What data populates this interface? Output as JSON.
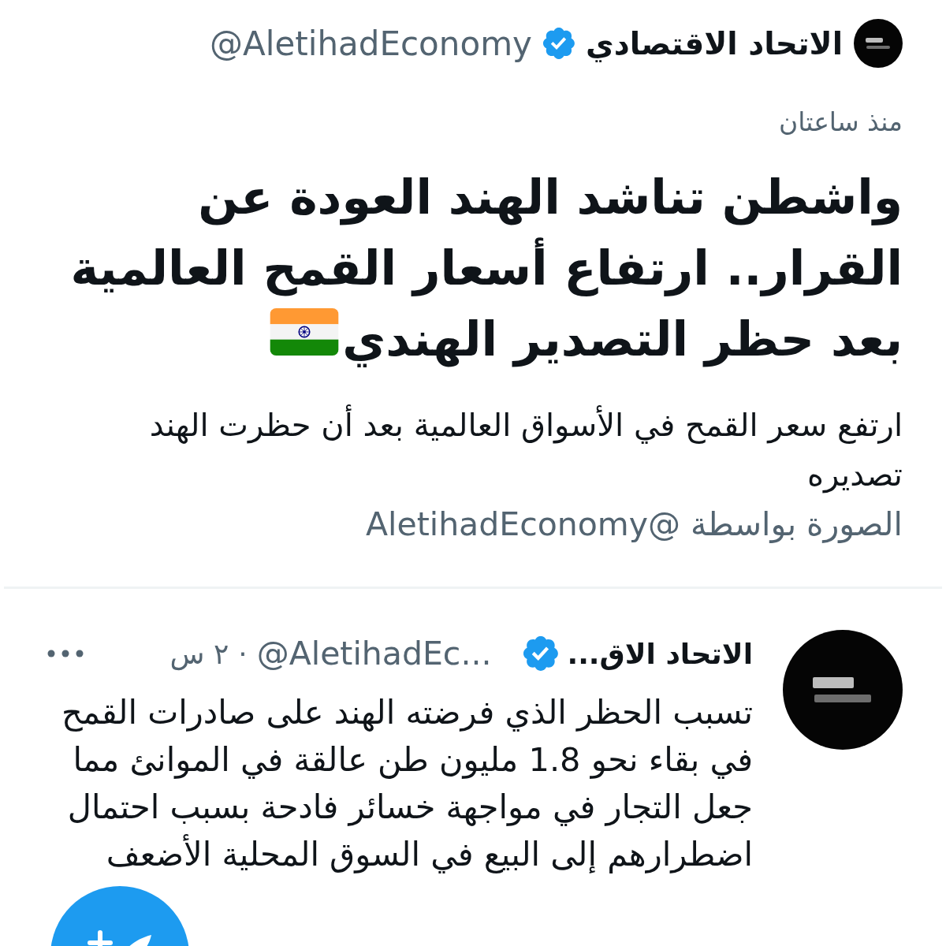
{
  "header": {
    "name": "الاتحاد الاقتصادي",
    "verified": true,
    "handle": "@AletihadEconomy"
  },
  "article": {
    "time": "منذ ساعتان",
    "title_lines": [
      "واشطن تناشد الهند العودة عن",
      "القرار.. ارتفاع أسعار القمح العالمية",
      "بعد حظر التصدير الهندي"
    ],
    "summary": "ارتفع سعر القمح في الأسواق العالمية بعد أن حظرت الهند تصديره",
    "credit": "الصورة بواسطة @AletihadEconomy"
  },
  "tweet": {
    "name": "الاتحاد الاق...",
    "verified": true,
    "handle": "@AletihadEc...",
    "separator": "·",
    "time": "٢ س",
    "text": "تسبب الحظر الذي فرضته الهند على صادرات القمح في بقاء نحو 1.8 مليون طن عالقة في الموانئ مما جعل التجار في مواجهة خسائر فادحة بسبب احتمال اضطرارهم إلى البيع في السوق المحلية الأضعف"
  }
}
